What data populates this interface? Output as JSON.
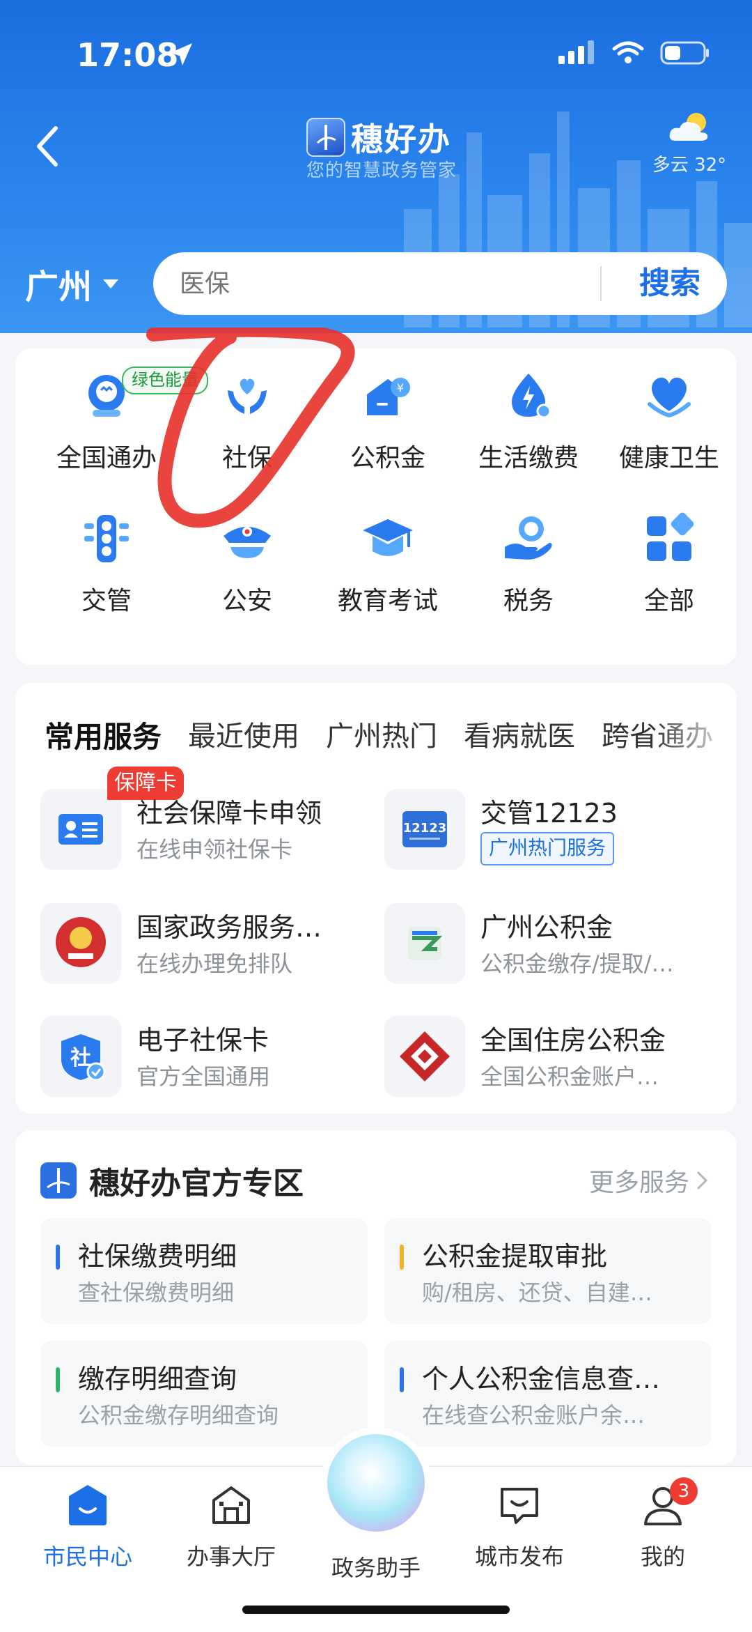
{
  "status_bar": {
    "time": "17:08"
  },
  "header": {
    "app_title": "穗好办",
    "app_subtitle": "您的智慧政务管家",
    "weather": "多云 32°",
    "city": "广州",
    "search_placeholder": "医保",
    "search_button": "搜索"
  },
  "grid": {
    "items": [
      {
        "label": "全国通办",
        "badge": "绿色能量",
        "icon": "national-service-icon"
      },
      {
        "label": "社保",
        "icon": "social-security-icon"
      },
      {
        "label": "公积金",
        "icon": "housing-fund-icon"
      },
      {
        "label": "生活缴费",
        "icon": "utility-payment-icon"
      },
      {
        "label": "健康卫生",
        "icon": "health-icon"
      },
      {
        "label": "交管",
        "icon": "traffic-icon"
      },
      {
        "label": "公安",
        "icon": "police-icon"
      },
      {
        "label": "教育考试",
        "icon": "education-icon"
      },
      {
        "label": "税务",
        "icon": "tax-icon"
      },
      {
        "label": "全部",
        "icon": "all-apps-icon"
      }
    ]
  },
  "services": {
    "tabs": [
      "常用服务",
      "最近使用",
      "广州热门",
      "看病就医",
      "跨省通办"
    ],
    "items": [
      {
        "title": "社会保障卡申领",
        "sub": "在线申领社保卡",
        "badge": "保障卡",
        "icon": "id-card-icon"
      },
      {
        "title": "交管12123",
        "tag": "广州热门服务",
        "icon": "traffic-12123-icon",
        "icon_text": "12123"
      },
      {
        "title": "国家政务服务…",
        "sub": "在线办理免排队",
        "icon": "national-emblem-icon"
      },
      {
        "title": "广州公积金",
        "sub": "公积金缴存/提取/…",
        "icon": "gz-fund-icon"
      },
      {
        "title": "电子社保卡",
        "sub": "官方全国通用",
        "icon": "e-social-card-icon",
        "icon_text": "社"
      },
      {
        "title": "全国住房公积金",
        "sub": "全国公积金账户…",
        "icon": "national-fund-icon"
      }
    ]
  },
  "official": {
    "title": "穗好办官方专区",
    "more": "更多服务",
    "items": [
      {
        "name": "社保缴费明细",
        "sub": "查社保缴费明细",
        "accent": "#2b73e8"
      },
      {
        "name": "公积金提取审批",
        "sub": "购/租房、还贷、自建…",
        "accent": "#f0b429"
      },
      {
        "name": "缴存明细查询",
        "sub": "公积金缴存明细查询",
        "accent": "#2fb36b"
      },
      {
        "name": "个人公积金信息查…",
        "sub": "在线查公积金账户余…",
        "accent": "#2b73e8"
      }
    ]
  },
  "tabbar": {
    "items": [
      {
        "label": "市民中心",
        "active": true
      },
      {
        "label": "办事大厅"
      },
      {
        "label": "政务助手"
      },
      {
        "label": "城市发布"
      },
      {
        "label": "我的",
        "badge": "3"
      }
    ]
  },
  "colors": {
    "primary": "#1c6fe6",
    "header_top": "#1b6de0",
    "badge_red": "#ee3b34",
    "badge_green": "#39b75a",
    "annotation": "#e8302a"
  }
}
